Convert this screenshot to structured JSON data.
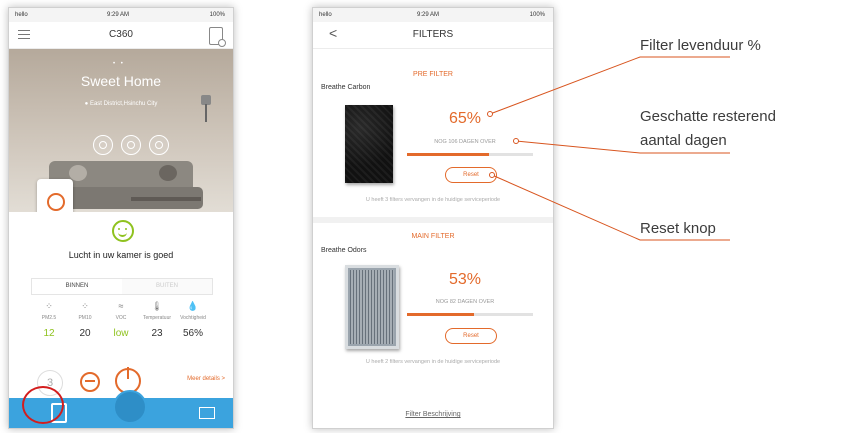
{
  "home_screen": {
    "status": {
      "carrier": "hello",
      "time": "9:29 AM",
      "battery": "100%"
    },
    "title": "C360",
    "hero": {
      "home_name": "Sweet Home",
      "location": "East District,Hsinchu City",
      "page_dots": "• •"
    },
    "air_quality_text": "Lucht in uw kamer is goed",
    "tabs": {
      "indoor": "BINNEN",
      "outdoor": "BUITEN"
    },
    "metrics": [
      {
        "icon": "pm25-icon",
        "label": "PM2.5",
        "value": "12",
        "color": "#8fc21f"
      },
      {
        "icon": "pm10-icon",
        "label": "PM10",
        "value": "20",
        "color": "#333333"
      },
      {
        "icon": "voc-icon",
        "label": "VOC",
        "value": "low",
        "color": "#8fc21f"
      },
      {
        "icon": "thermometer-icon",
        "label": "Temperatuur",
        "value": "23",
        "color": "#333333"
      },
      {
        "icon": "humidity-icon",
        "label": "Vochtigheid",
        "value": "56%",
        "color": "#333333"
      }
    ],
    "fan_level": "3",
    "more_details": "Meer details >",
    "tabbar": {
      "accent": "#3ba3de"
    }
  },
  "filters_screen": {
    "status": {
      "carrier": "hello",
      "time": "9:29 AM",
      "battery": "100%"
    },
    "back_symbol": "<",
    "title": "FILTERS",
    "filters": [
      {
        "section": "PRE FILTER",
        "name": "Breathe Carbon",
        "percent": "65%",
        "life_fraction": 0.65,
        "days_text": "NOG 106 DAGEN OVER",
        "reset_label": "Reset",
        "service_note": "U heeft 3 filters vervangen in de huidige serviceperiode"
      },
      {
        "section": "MAIN FILTER",
        "name": "Breathe Odors",
        "percent": "53%",
        "life_fraction": 0.53,
        "days_text": "NOG 82 DAGEN OVER",
        "reset_label": "Reset",
        "service_note": "U heeft 2 filters vervangen in de huidige serviceperiode"
      }
    ],
    "filter_description_link": "Filter Beschrijving"
  },
  "annotations": {
    "life_label": "Filter levenduur %",
    "days_label_line1": "Geschatte resterend",
    "days_label_line2": "aantal dagen",
    "reset_label": "Reset knop",
    "line_color": "#d8551f"
  },
  "colors": {
    "accent_orange": "#e36a2b",
    "good_green": "#8fc21f",
    "highlight_red": "#d31d1d"
  }
}
